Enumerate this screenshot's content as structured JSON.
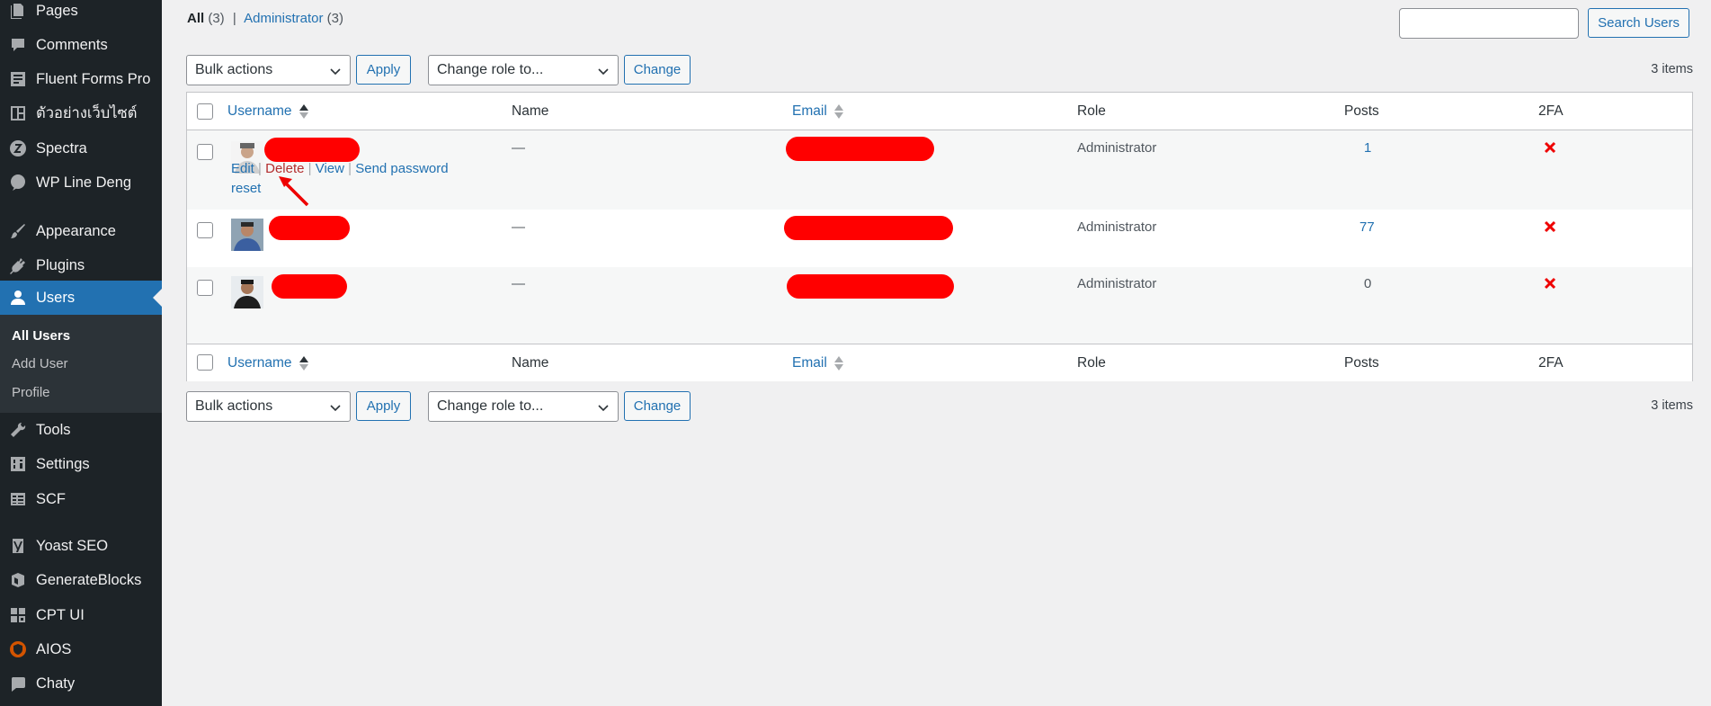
{
  "sidebar": {
    "items": [
      {
        "label": "Pages",
        "icon": "pages-icon"
      },
      {
        "label": "Comments",
        "icon": "comments-icon"
      },
      {
        "label": "Fluent Forms Pro",
        "icon": "forms-icon"
      },
      {
        "label": "ตัวอย่างเว็บไซต์",
        "icon": "layout-icon"
      },
      {
        "label": "Spectra",
        "icon": "spectra-icon"
      },
      {
        "label": "WP Line Deng",
        "icon": "chat-icon"
      },
      {
        "label": "Appearance",
        "icon": "brush-icon"
      },
      {
        "label": "Plugins",
        "icon": "plug-icon"
      },
      {
        "label": "Users",
        "icon": "user-icon"
      },
      {
        "label": "Tools",
        "icon": "wrench-icon"
      },
      {
        "label": "Settings",
        "icon": "settings-icon"
      },
      {
        "label": "SCF",
        "icon": "table-icon"
      },
      {
        "label": "Yoast SEO",
        "icon": "yoast-icon"
      },
      {
        "label": "GenerateBlocks",
        "icon": "blocks-icon"
      },
      {
        "label": "CPT UI",
        "icon": "grid-icon"
      },
      {
        "label": "AIOS",
        "icon": "shield-icon"
      },
      {
        "label": "Chaty",
        "icon": "chat-bubble-icon"
      }
    ],
    "submenu": [
      "All Users",
      "Add User",
      "Profile"
    ]
  },
  "views": {
    "all_label": "All",
    "all_count": "(3)",
    "separator": "|",
    "admin_label": "Administrator",
    "admin_count": "(3)"
  },
  "search": {
    "button": "Search Users",
    "value": ""
  },
  "tablenav": {
    "bulk_actions": "Bulk actions",
    "apply": "Apply",
    "change_role": "Change role to...",
    "change": "Change",
    "items_count": "3 items"
  },
  "columns": {
    "username": "Username",
    "name": "Name",
    "email": "Email",
    "role": "Role",
    "posts": "Posts",
    "twofa": "2FA"
  },
  "rows": [
    {
      "name": "—",
      "role": "Administrator",
      "posts": "1",
      "twofa": "✖"
    },
    {
      "name": "—",
      "role": "Administrator",
      "posts": "77",
      "twofa": "✖"
    },
    {
      "name": "—",
      "role": "Administrator",
      "posts": "0",
      "twofa": "✖"
    }
  ],
  "row_actions": {
    "edit": "Edit",
    "delete": "Delete",
    "view": "View",
    "send_password": "Send password",
    "reset": "reset",
    "sep": "|"
  },
  "colors": {
    "sidebar_bg": "#1d2327",
    "accent": "#2271b1",
    "redaction": "#ff0000",
    "delete": "#b32d2e"
  }
}
